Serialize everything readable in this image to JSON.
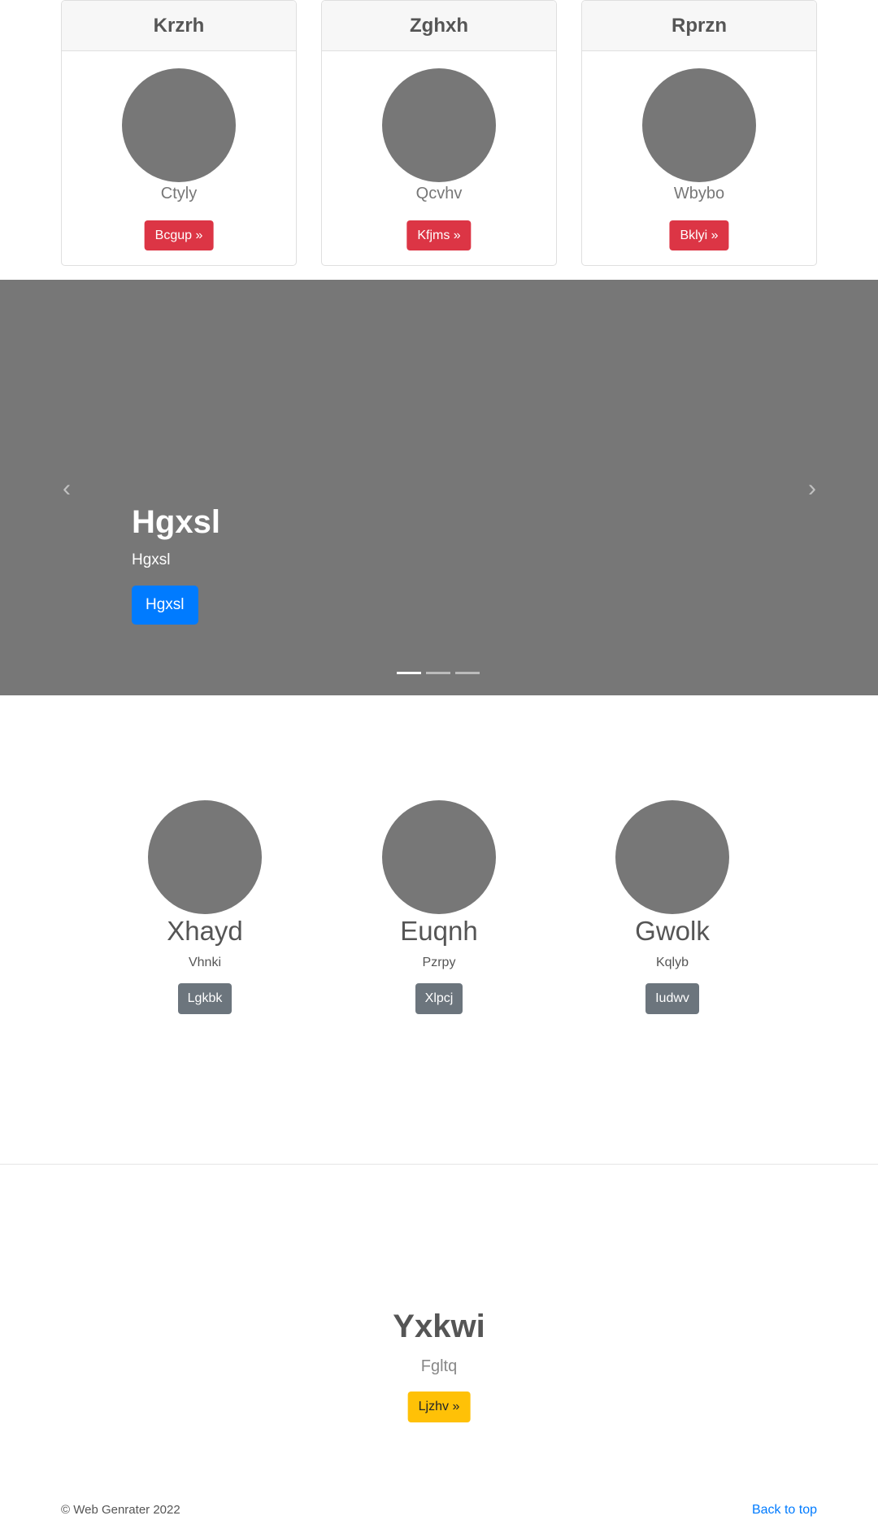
{
  "cards": [
    {
      "title": "Krzrh",
      "subtitle": "Ctyly",
      "button": "Bcgup »"
    },
    {
      "title": "Zghxh",
      "subtitle": "Qcvhv",
      "button": "Kfjms »"
    },
    {
      "title": "Rprzn",
      "subtitle": "Wbybo",
      "button": "Bklyi »"
    }
  ],
  "carousel": {
    "title": "Hgxsl",
    "text": "Hgxsl",
    "button": "Hgxsl",
    "prev_icon": "‹",
    "next_icon": "›",
    "slide_count": 3,
    "active_slide": 1
  },
  "columns": [
    {
      "title": "Xhayd",
      "text": "Vhnki",
      "button": "Lgkbk"
    },
    {
      "title": "Euqnh",
      "text": "Pzrpy",
      "button": "Xlpcj"
    },
    {
      "title": "Gwolk",
      "text": "Kqlyb",
      "button": "Iudwv"
    }
  ],
  "featurette": {
    "title": "Yxkwi",
    "text": "Fgltq",
    "button": "Ljzhv »"
  },
  "footer": {
    "copyright": "© Web Genrater 2022",
    "back_to_top": "Back to top"
  },
  "colors": {
    "placeholder_gray": "#777777",
    "danger": "#dc3545",
    "primary": "#007bff",
    "secondary": "#6c757d",
    "warning": "#ffc107"
  }
}
